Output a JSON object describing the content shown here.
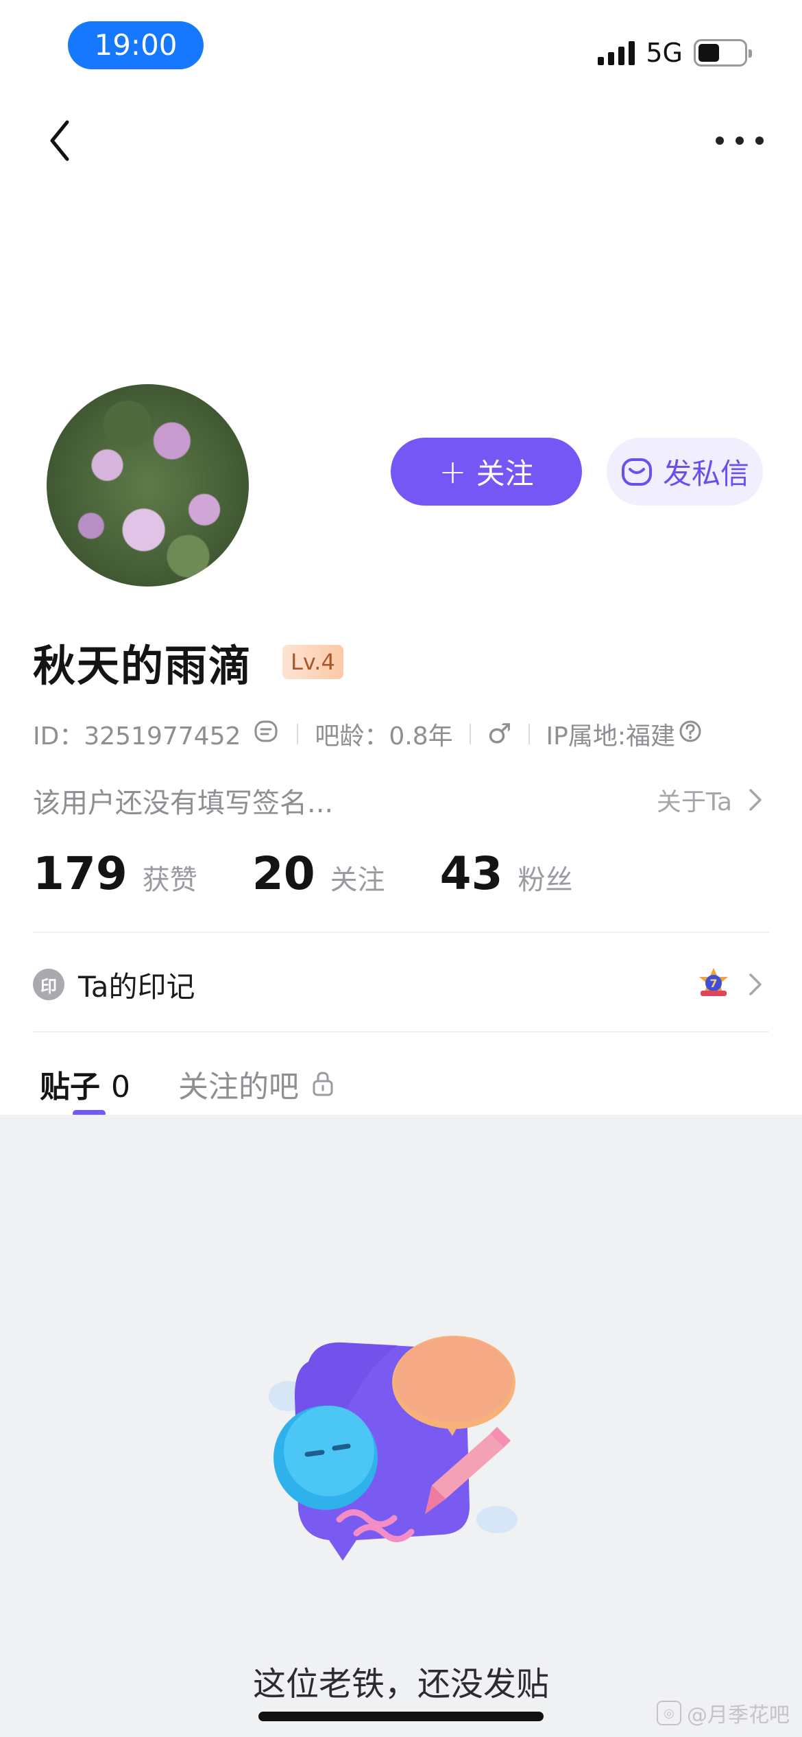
{
  "status_bar": {
    "time": "19:00",
    "network": "5G"
  },
  "profile": {
    "follow_label": "关注",
    "follow_plus": "+",
    "message_label": "发私信",
    "name": "秋天的雨滴",
    "level": "Lv.4",
    "id_text": "ID：3251977452",
    "age_text": "吧龄：0.8年",
    "gender_symbol": "♂",
    "ip_text": "IP属地:福建",
    "signature": "该用户还没有填写签名...",
    "about_label": "关于Ta"
  },
  "stats": [
    {
      "value": "179",
      "label": "获赞"
    },
    {
      "value": "20",
      "label": "关注"
    },
    {
      "value": "43",
      "label": "粉丝"
    }
  ],
  "imprint": {
    "icon_char": "印",
    "label": "Ta的印记",
    "medal_number": "7"
  },
  "tabs": {
    "posts_label": "贴子",
    "posts_count": "0",
    "bars_label": "关注的吧"
  },
  "empty_state": {
    "text": "这位老铁，还没发贴"
  },
  "watermark": {
    "text": "@月季花吧"
  },
  "colors": {
    "accent": "#7557f5",
    "time_pill": "#1677ff",
    "background_content": "#f0f1f3"
  }
}
